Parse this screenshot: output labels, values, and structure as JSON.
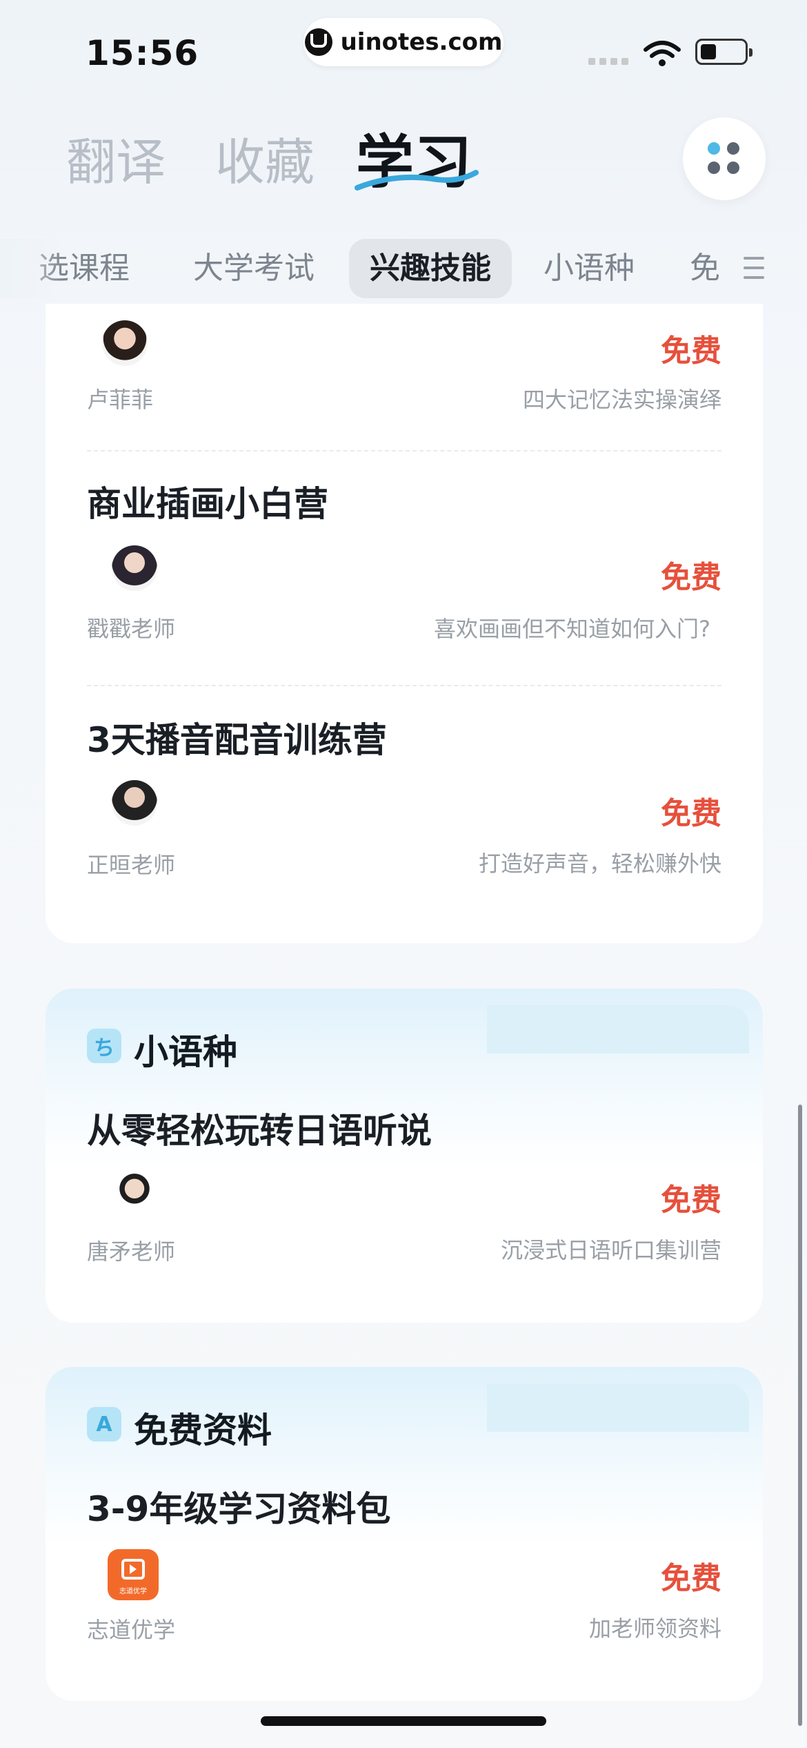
{
  "status_bar": {
    "time": "15:56",
    "url": "uinotes.com"
  },
  "header": {
    "tabs": [
      "翻译",
      "收藏",
      "学习"
    ],
    "active_tab": "学习"
  },
  "categories": {
    "items": [
      "精选课程",
      "大学考试",
      "兴趣技能",
      "小语种",
      "免"
    ],
    "partial_first": "选课程",
    "active": "兴趣技能"
  },
  "courses": [
    {
      "title": "",
      "teacher": "卢菲菲",
      "price": "免费",
      "desc": "四大记忆法实操演绎"
    },
    {
      "title": "商业插画小白营",
      "teacher": "戳戳老师",
      "price": "免费",
      "desc": "喜欢画画但不知道如何入门?"
    },
    {
      "title": "3天播音配音训练营",
      "teacher": "正晅老师",
      "price": "免费",
      "desc": "打造好声音，轻松赚外快"
    }
  ],
  "sections": [
    {
      "badge": "ち",
      "name": "小语种",
      "title": "从零轻松玩转日语听说",
      "teacher": "唐矛老师",
      "price": "免费",
      "desc": "沉浸式日语听口集训营"
    },
    {
      "badge": "A",
      "name": "免费资料",
      "title": "3-9年级学习资料包",
      "teacher": "志道优学",
      "price": "免费",
      "desc": "加老师领资料",
      "logo_text": "志道优学"
    }
  ],
  "colors": {
    "price": "#e6503c",
    "accent": "#3aa8dc"
  }
}
